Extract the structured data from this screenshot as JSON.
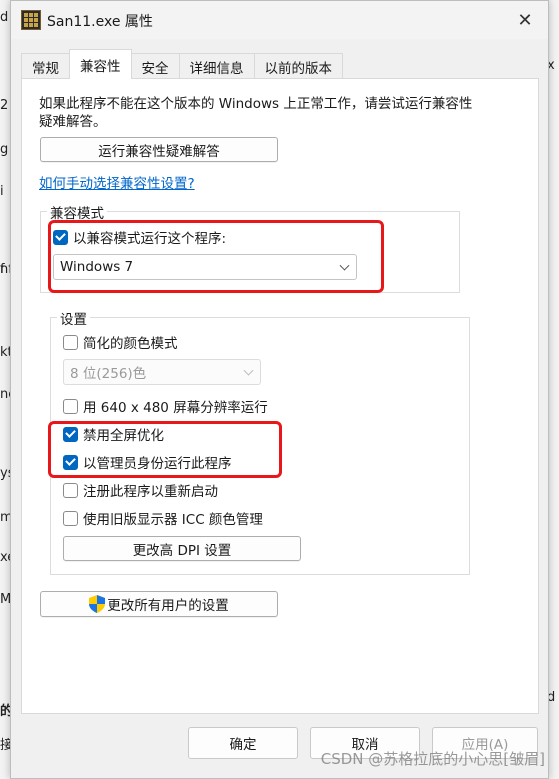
{
  "background_fragments_left": [
    "d",
    "2",
    "g",
    "f",
    "i",
    "nf",
    "kt",
    "ne",
    "ys",
    "m",
    "xe",
    "Ma",
    "的",
    "接"
  ],
  "background_fragments_right": [
    "x",
    "d"
  ],
  "window": {
    "title": "San11.exe 属性",
    "close_glyph": "✕"
  },
  "tabs": [
    {
      "label": "常规",
      "active": false
    },
    {
      "label": "兼容性",
      "active": true
    },
    {
      "label": "安全",
      "active": false
    },
    {
      "label": "详细信息",
      "active": false
    },
    {
      "label": "以前的版本",
      "active": false
    }
  ],
  "intro_text": "如果此程序不能在这个版本的 Windows 上正常工作，请尝试运行兼容性疑难解答。",
  "troubleshooter_button": "运行兼容性疑难解答",
  "manual_link": "如何手动选择兼容性设置?",
  "compat_mode": {
    "group_label": "兼容模式",
    "checkbox_label": "以兼容模式运行这个程序:",
    "checked": true,
    "selected_os": "Windows 7"
  },
  "settings": {
    "group_label": "设置",
    "reduced_color": {
      "label": "简化的颜色模式",
      "checked": false
    },
    "color_select": "8 位(256)色",
    "res_640": {
      "label": "用 640 x 480 屏幕分辨率运行",
      "checked": false
    },
    "disable_fullscreen": {
      "label": "禁用全屏优化",
      "checked": true
    },
    "run_as_admin": {
      "label": "以管理员身份运行此程序",
      "checked": true
    },
    "register_restart": {
      "label": "注册此程序以重新启动",
      "checked": false
    },
    "legacy_icc": {
      "label": "使用旧版显示器 ICC 颜色管理",
      "checked": false
    },
    "dpi_button": "更改高 DPI 设置"
  },
  "all_users_button": "更改所有用户的设置",
  "footer": {
    "ok": "确定",
    "cancel": "取消",
    "apply": "应用(A)"
  },
  "watermark": "CSDN @苏格拉底的小心思[皱眉]",
  "colors": {
    "accent": "#0067c0",
    "highlight_box": "#e8171a",
    "link": "#0066cc"
  }
}
